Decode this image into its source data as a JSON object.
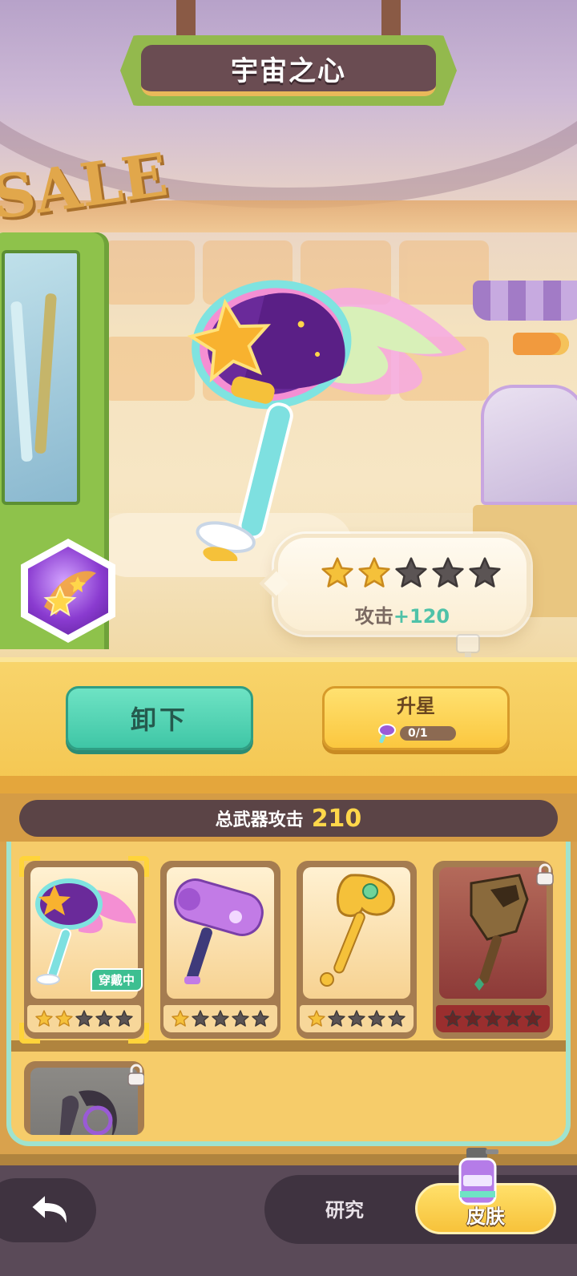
{
  "header": {
    "title": "宇宙之心"
  },
  "scene": {
    "sign": "SALE"
  },
  "weapon_detail": {
    "stars_filled": 2,
    "stars_total": 5,
    "stat_label": "攻击",
    "stat_bonus": "+120"
  },
  "actions": {
    "unequip_label": "卸下",
    "upgrade_label": "升星",
    "upgrade_cost": "0/1"
  },
  "summary": {
    "total_label": "总武器攻击",
    "total_value": "210"
  },
  "inventory": {
    "items": [
      {
        "icon": "cosmic-star-hammer",
        "stars_filled": 2,
        "stars_total": 5,
        "equipped": true,
        "tag": "穿戴中",
        "locked": false
      },
      {
        "icon": "purple-cat-hammer",
        "stars_filled": 1,
        "stars_total": 5,
        "equipped": false,
        "locked": false
      },
      {
        "icon": "golden-scepter",
        "stars_filled": 1,
        "stars_total": 5,
        "equipped": false,
        "locked": false
      },
      {
        "icon": "wooden-wolf-axe",
        "stars_filled": 0,
        "stars_total": 5,
        "equipped": false,
        "locked": true
      },
      {
        "icon": "dark-crescent-blade",
        "locked": true
      }
    ]
  },
  "nav": {
    "research_tab": "研究",
    "skin_tab": "皮肤"
  },
  "colors": {
    "star_filled": "#f5c13a",
    "star_empty": "#5b5454",
    "accent_teal": "#3fc6a6",
    "accent_gold": "#ffd74a"
  }
}
